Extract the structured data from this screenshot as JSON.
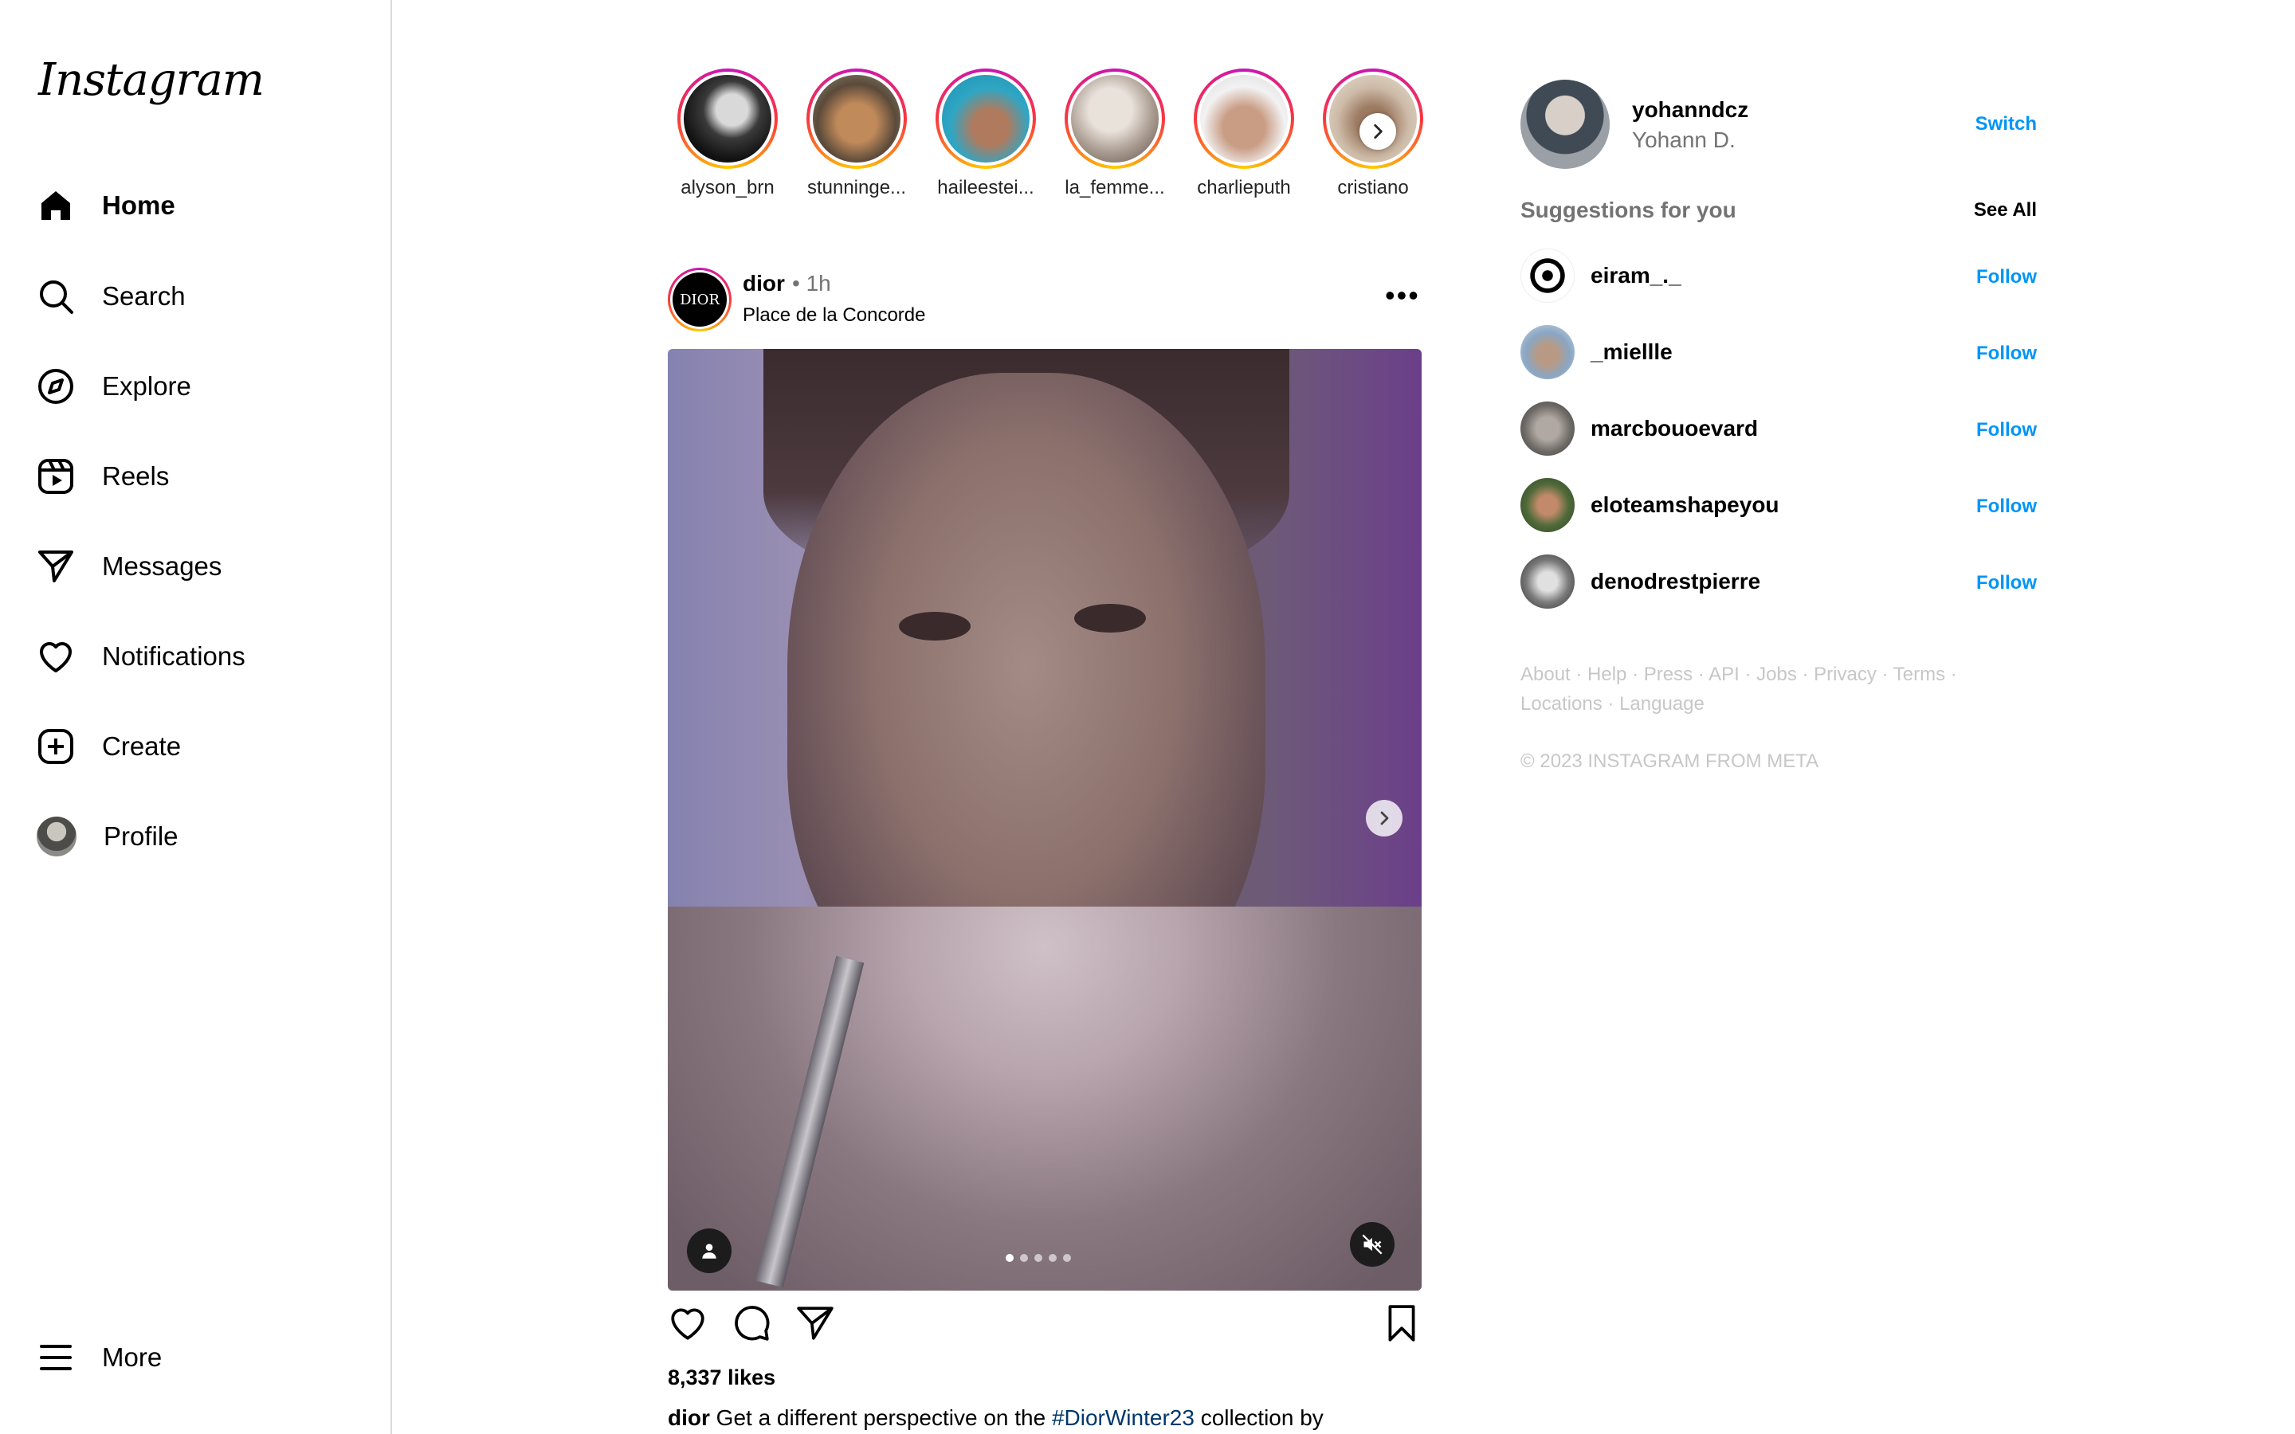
{
  "brand": {
    "logo_text": "Instagram"
  },
  "nav": {
    "items": [
      {
        "label": "Home"
      },
      {
        "label": "Search"
      },
      {
        "label": "Explore"
      },
      {
        "label": "Reels"
      },
      {
        "label": "Messages"
      },
      {
        "label": "Notifications"
      },
      {
        "label": "Create"
      },
      {
        "label": "Profile"
      }
    ],
    "more_label": "More"
  },
  "stories": [
    {
      "username": "alyson_brn"
    },
    {
      "username": "stunninge..."
    },
    {
      "username": "haileestei..."
    },
    {
      "username": "la_femme..."
    },
    {
      "username": "charlieputh"
    },
    {
      "username": "cristiano"
    }
  ],
  "post": {
    "username": "dior",
    "avatar_text": "DIOR",
    "time": "• 1h",
    "location": "Place de la Concorde",
    "more_glyph": "•••",
    "likes": "8,337 likes",
    "caption_user": "dior",
    "caption_pre": " Get a different perspective on the ",
    "caption_tag": "#DiorWinter23",
    "caption_post": " collection by",
    "slide_count": 5,
    "slide_active": 1
  },
  "account": {
    "username": "yohanndcz",
    "name": "Yohann D.",
    "switch_label": "Switch"
  },
  "suggestions": {
    "title": "Suggestions for you",
    "see_all": "See All",
    "follow_label": "Follow",
    "users": [
      {
        "username": "eiram_._"
      },
      {
        "username": "_miellle"
      },
      {
        "username": "marcbouoevard"
      },
      {
        "username": "eloteamshapeyou"
      },
      {
        "username": "denodrestpierre"
      }
    ]
  },
  "footer": {
    "links": [
      "About",
      "Help",
      "Press",
      "API",
      "Jobs",
      "Privacy",
      "Terms",
      "Locations",
      "Language"
    ],
    "separator": " · ",
    "copyright": "© 2023 INSTAGRAM FROM META"
  },
  "colors": {
    "accent_blue": "#0095f6",
    "muted_text": "#737373",
    "border": "#dbdbdb",
    "story_ring": [
      "#c913b9",
      "#f9373f",
      "#fecd00"
    ]
  }
}
